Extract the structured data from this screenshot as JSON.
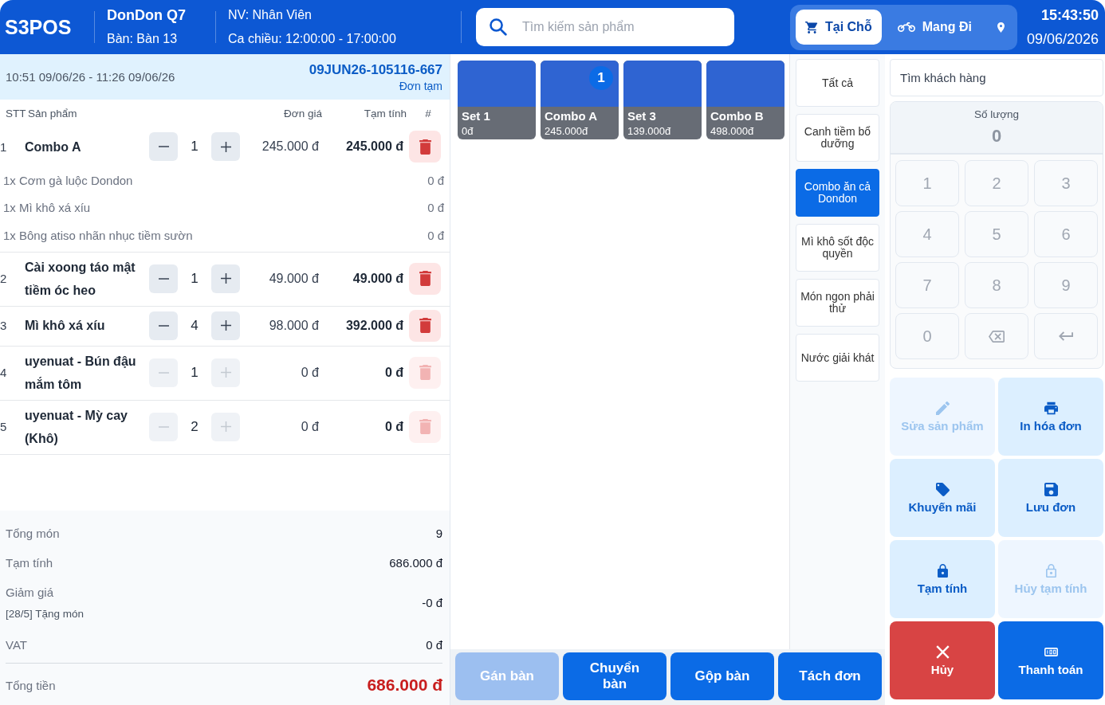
{
  "header": {
    "logo": "S3POS",
    "store": "DonDon Q7",
    "table": "Bàn: Bàn 13",
    "staff": "NV: Nhân Viên",
    "shift": "Ca chiều: 12:00:00 - 17:00:00",
    "search": {
      "placeholder": "Tìm kiếm sản phẩm"
    },
    "order_types": [
      {
        "label": "Tại Chỗ",
        "selected": true
      },
      {
        "label": "Mang Đi",
        "selected": false
      }
    ],
    "time": "15:43:50",
    "date": "09/06/2026"
  },
  "order": {
    "time_range": "10:51 09/06/26 - 11:26 09/06/26",
    "code": "09JUN26-105116-667",
    "status": "Đơn tạm",
    "columns": [
      "STT",
      "Sản phẩm",
      "Đơn giá",
      "Tạm tính",
      "#"
    ],
    "rows": [
      {
        "no": "1",
        "name": "Combo A",
        "qty": "1",
        "unit_price": "245.000 đ",
        "total": "245.000 đ",
        "disabled": false,
        "children": [
          {
            "name": "1x Cơm gà luộc Dondon",
            "price": "0 đ"
          },
          {
            "name": "1x Mì khô xá xíu",
            "price": "0 đ"
          },
          {
            "name": "1x Bông atiso nhãn nhục tiềm sườn",
            "price": "0 đ"
          }
        ]
      },
      {
        "no": "2",
        "name": "Cài xoong táo mật tiềm óc heo",
        "qty": "1",
        "unit_price": "49.000 đ",
        "total": "49.000 đ",
        "disabled": false
      },
      {
        "no": "3",
        "name": "Mì khô xá xíu",
        "qty": "4",
        "unit_price": "98.000 đ",
        "total": "392.000 đ",
        "disabled": false
      },
      {
        "no": "4",
        "name": "uyenuat - Bún đậu mắm tôm",
        "qty": "1",
        "unit_price": "0 đ",
        "total": "0 đ",
        "disabled": true
      },
      {
        "no": "5",
        "name": "uyenuat - Mỳ cay (Khô)",
        "qty": "2",
        "unit_price": "0 đ",
        "total": "0 đ",
        "disabled": true
      }
    ]
  },
  "totals": {
    "lines": [
      {
        "label": "Tổng món",
        "value": "9"
      },
      {
        "label": "Tạm tính",
        "value": "686.000 đ"
      },
      {
        "label": "Giảm giá",
        "note": "[28/5] Tặng món",
        "value": "-0 đ"
      },
      {
        "label": "VAT",
        "value": "0 đ"
      }
    ],
    "grand_total": {
      "label": "Tổng tiền",
      "value": "686.000 đ"
    }
  },
  "products": [
    {
      "name": "Set 1",
      "price": "0đ"
    },
    {
      "name": "Combo A",
      "price": "245.000đ",
      "count": "1"
    },
    {
      "name": "Set 3",
      "price": "139.000đ"
    },
    {
      "name": "Combo B",
      "price": "498.000đ"
    }
  ],
  "categories": [
    {
      "label": "Tất cả",
      "selected": false
    },
    {
      "label": "Canh tiềm bổ dưỡng",
      "selected": false
    },
    {
      "label": "Combo ăn cả Dondon",
      "selected": true
    },
    {
      "label": "Mì khô sốt độc quyền",
      "selected": false
    },
    {
      "label": "Món ngon phải thử",
      "selected": false
    },
    {
      "label": "Nước giải khát",
      "selected": false
    }
  ],
  "table_actions": [
    {
      "label": "Gán bàn",
      "disabled": true
    },
    {
      "label": "Chuyển bàn",
      "disabled": false
    },
    {
      "label": "Gộp bàn",
      "disabled": false
    },
    {
      "label": "Tách đơn",
      "disabled": false
    }
  ],
  "customer_search": {
    "placeholder": "Tìm khách hàng"
  },
  "keypad": {
    "label": "Số lượng",
    "value": "0",
    "keys": [
      {
        "kind": "digit",
        "label": "1"
      },
      {
        "kind": "digit",
        "label": "2"
      },
      {
        "kind": "digit",
        "label": "3"
      },
      {
        "kind": "digit",
        "label": "4"
      },
      {
        "kind": "digit",
        "label": "5"
      },
      {
        "kind": "digit",
        "label": "6"
      },
      {
        "kind": "digit",
        "label": "7"
      },
      {
        "kind": "digit",
        "label": "8"
      },
      {
        "kind": "digit",
        "label": "9"
      },
      {
        "kind": "digit",
        "label": "0"
      },
      {
        "kind": "backspace"
      },
      {
        "kind": "enter"
      }
    ]
  },
  "actions": [
    {
      "label": "Sửa sản phẩm",
      "kind": "soft",
      "disabled": true
    },
    {
      "label": "In hóa đơn",
      "kind": "soft",
      "disabled": false
    },
    {
      "label": "Khuyến mãi",
      "kind": "soft",
      "disabled": false
    },
    {
      "label": "Lưu đơn",
      "kind": "soft",
      "disabled": false
    },
    {
      "label": "Tạm tính",
      "kind": "soft",
      "disabled": false
    },
    {
      "label": "Hủy tạm tính",
      "kind": "soft",
      "disabled": true
    },
    {
      "label": "Hủy",
      "kind": "danger",
      "disabled": false
    },
    {
      "label": "Thanh toán",
      "kind": "primary",
      "disabled": false
    }
  ]
}
